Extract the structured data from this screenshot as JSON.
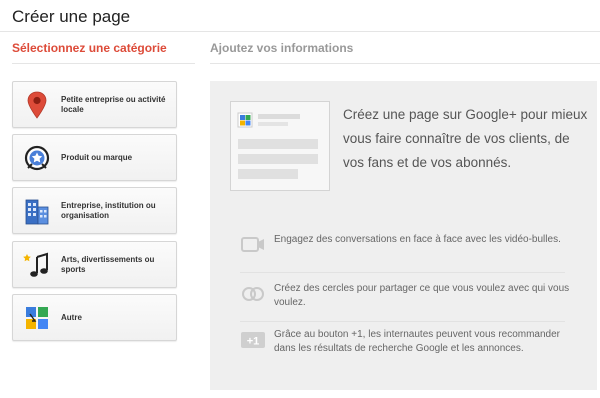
{
  "header": {
    "title": "Créer une page"
  },
  "steps": {
    "step1": "Sélectionnez une catégorie",
    "step2": "Ajoutez vos informations"
  },
  "categories": [
    {
      "label": "Petite entreprise ou activité locale",
      "icon": "map-pin-icon"
    },
    {
      "label": "Produit ou marque",
      "icon": "product-badge-icon"
    },
    {
      "label": "Entreprise, institution ou organisation",
      "icon": "building-icon"
    },
    {
      "label": "Arts, divertissements ou sports",
      "icon": "music-note-icon"
    },
    {
      "label": "Autre",
      "icon": "google-plus-squares-icon"
    }
  ],
  "info": {
    "headline": "Créez une page sur Google+ pour mieux vous faire connaître de vos clients, de vos fans et de vos abonnés.",
    "features": [
      {
        "icon": "video-chat-icon",
        "text": "Engagez des conversations en face à face avec les vidéo-bulles."
      },
      {
        "icon": "circles-icon",
        "text": "Créez des cercles pour partager ce que vous voulez avec qui vous voulez."
      },
      {
        "icon": "plus-one-icon",
        "text": "Grâce au bouton +1, les internautes peuvent vous recommander dans les résultats de recherche Google et les annonces."
      }
    ]
  },
  "colors": {
    "accent": "#dd4b39",
    "panel": "#efefef",
    "muted": "#999999"
  }
}
